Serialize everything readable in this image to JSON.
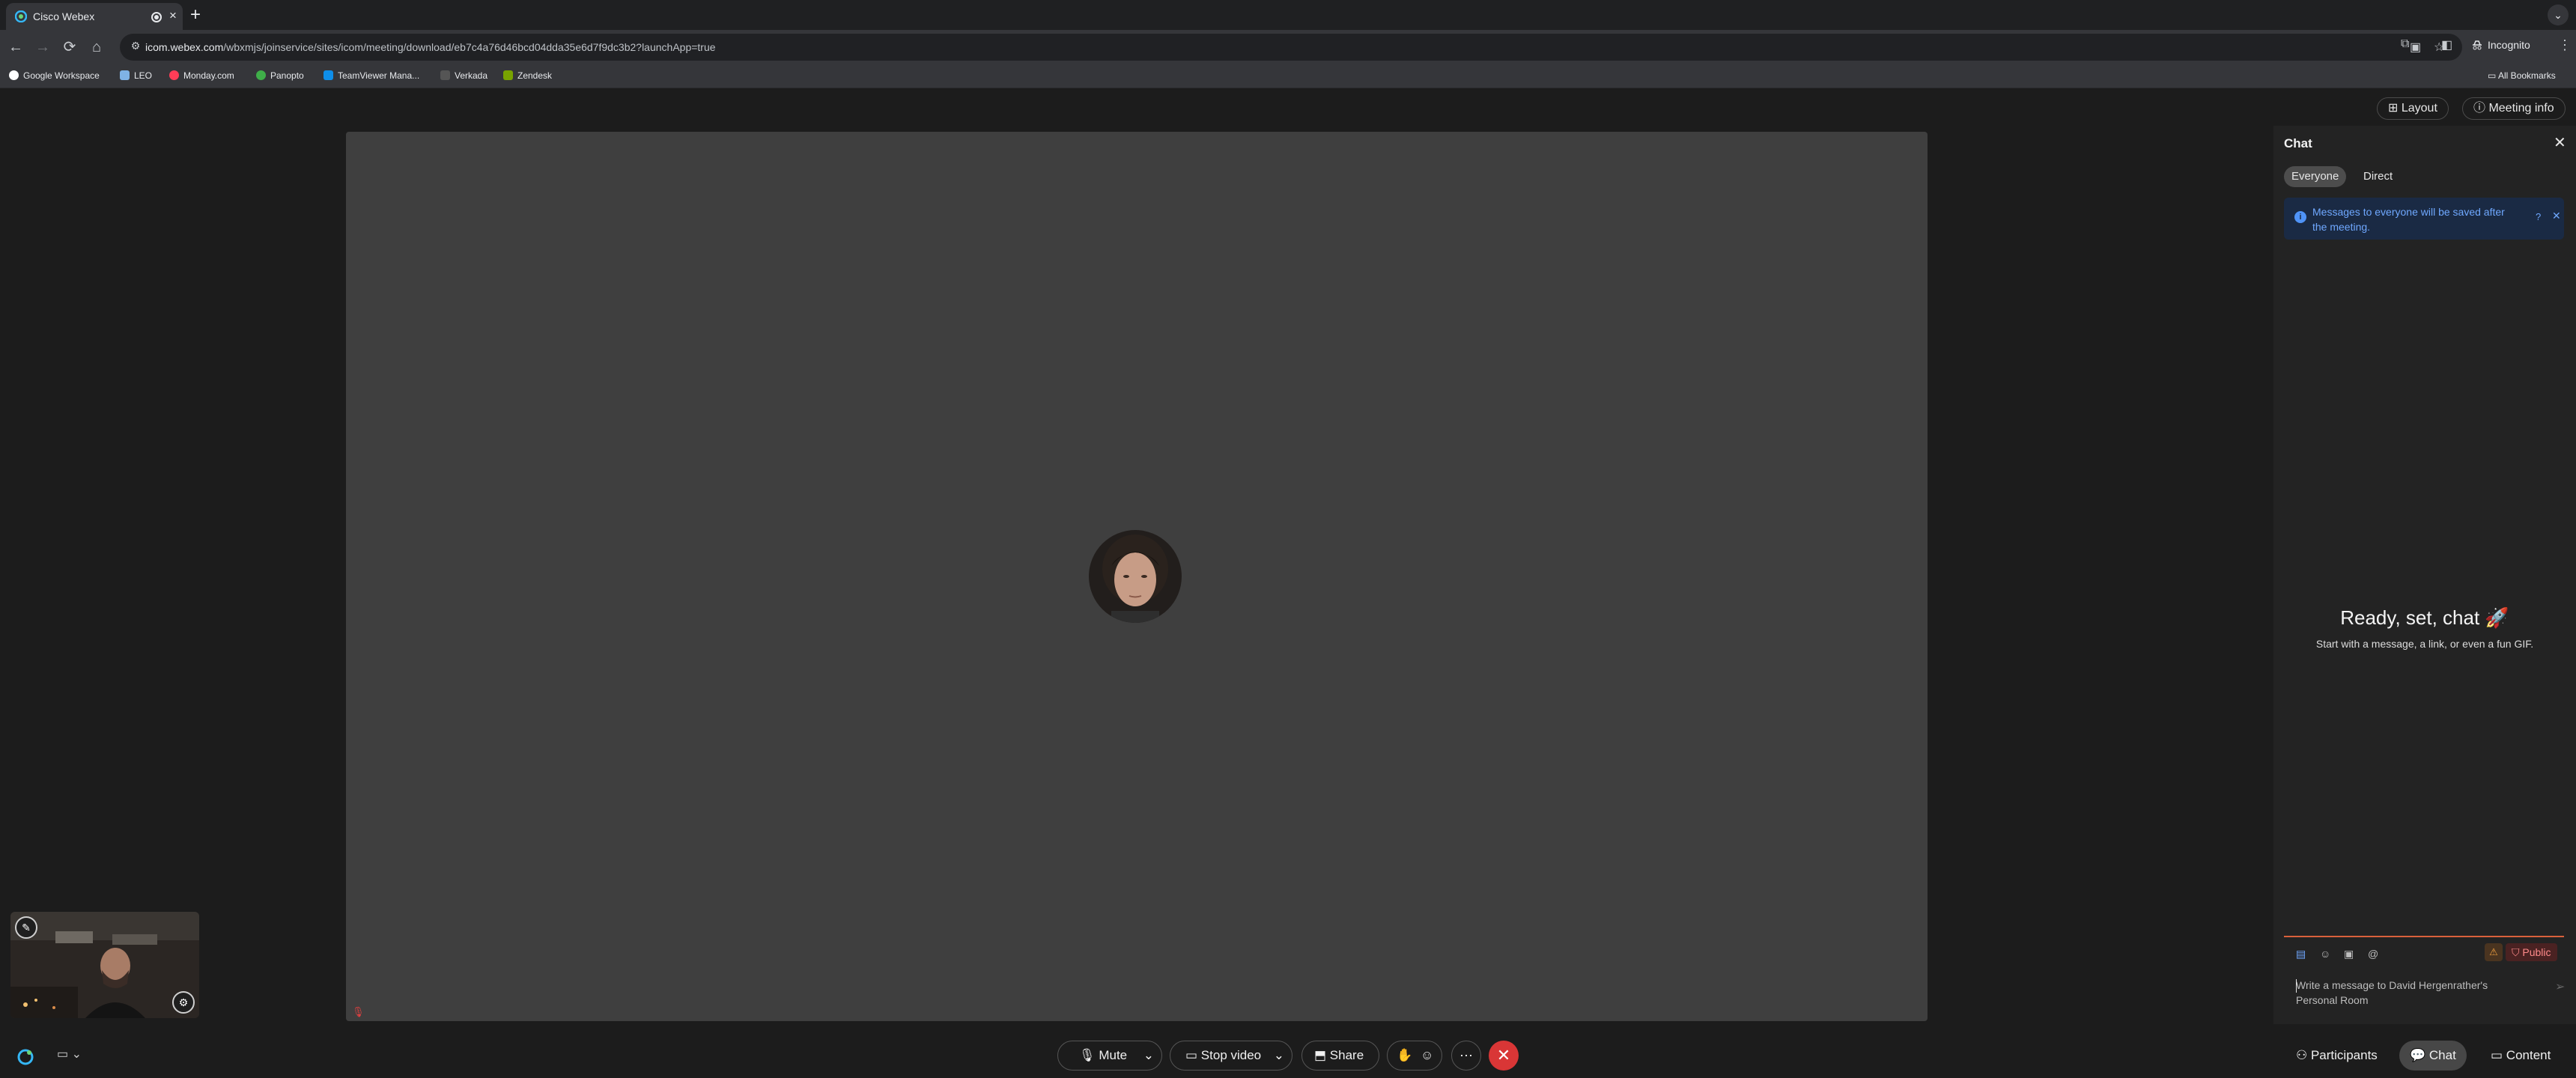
{
  "browser": {
    "tab_title": "Cisco Webex",
    "tab_close": "×",
    "new_tab": "+",
    "url_domain": "icom.webex.com",
    "url_path": "/wbxmjs/joinservice/sites/icom/meeting/download/eb7c4a76d46bcd04dda35e6d7f9dc3b2?launchApp=true",
    "incognito_label": "Incognito",
    "all_bookmarks_label": "All Bookmarks",
    "bookmarks": [
      {
        "label": "Google Workspace",
        "color": "#4285f4"
      },
      {
        "label": "LEO",
        "color": "#7fb2e5"
      },
      {
        "label": "Monday.com",
        "color": "#ff3d57"
      },
      {
        "label": "Panopto",
        "color": "#3fae49"
      },
      {
        "label": "TeamViewer Mana...",
        "color": "#0e8ee9"
      },
      {
        "label": "Verkada",
        "color": "#333333"
      },
      {
        "label": "Zendesk",
        "color": "#78a300"
      }
    ]
  },
  "meeting": {
    "layout_label": "Layout",
    "meeting_info_label": "Meeting info",
    "controls": {
      "mute_label": "Mute",
      "stop_video_label": "Stop video",
      "share_label": "Share"
    },
    "panel_tabs": {
      "participants_label": "Participants",
      "chat_label": "Chat",
      "content_label": "Content"
    },
    "colors": {
      "end_call": "#d93636",
      "accent": "#4f93f7"
    }
  },
  "chat": {
    "title": "Chat",
    "tabs": {
      "everyone": "Everyone",
      "direct": "Direct"
    },
    "banner_text": "Messages to everyone will be saved after the meeting.",
    "empty_title": "Ready, set, chat 🚀",
    "empty_subtitle": "Start with a message, a link, or even a fun GIF.",
    "public_label": "Public",
    "compose_placeholder": "Write a message to David Hergenrather's Personal Room"
  }
}
